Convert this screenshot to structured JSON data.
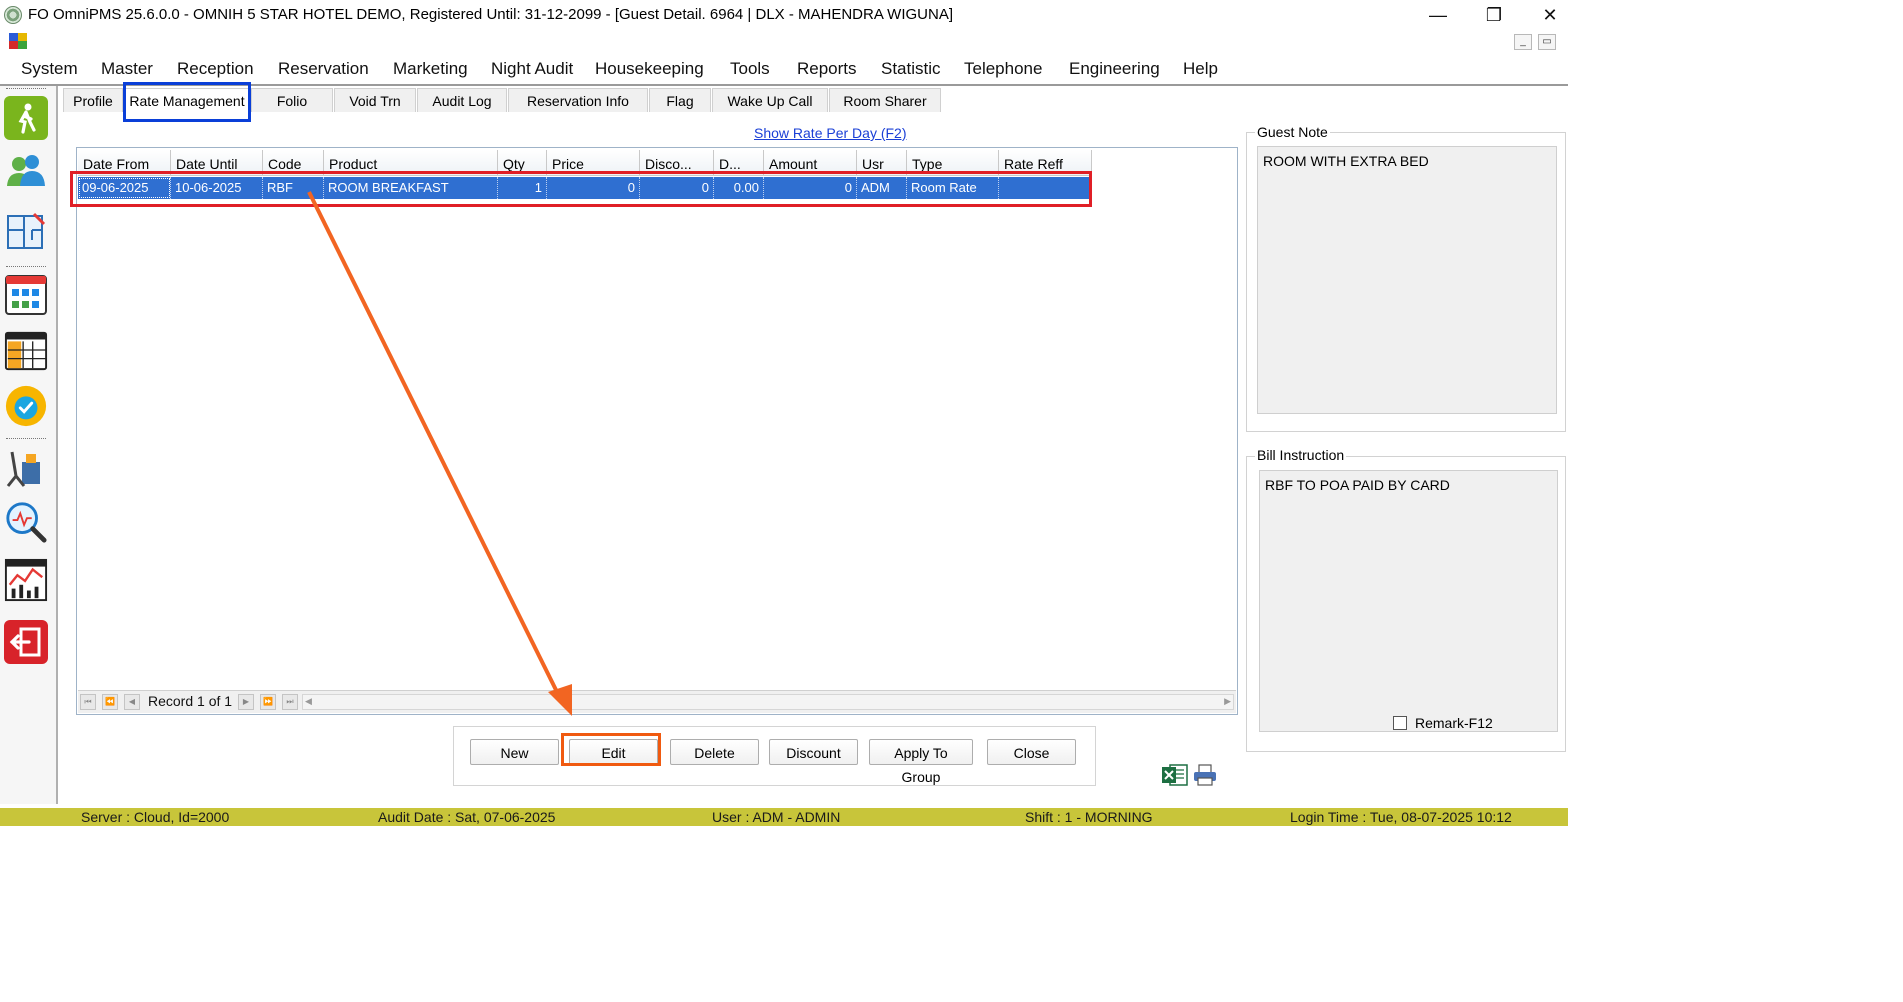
{
  "window": {
    "title": "FO OmniPMS 25.6.0.0 - OMNIH 5 STAR HOTEL DEMO, Registered Until: 31-12-2099 - [Guest Detail. 6964 | DLX - MAHENDRA WIGUNA]",
    "minimize": "—",
    "restore": "❐",
    "close": "✕"
  },
  "mdi": {
    "minimize": "_",
    "restore": "▭"
  },
  "menu": [
    "System",
    "Master",
    "Reception",
    "Reservation",
    "Marketing",
    "Night Audit",
    "Housekeeping",
    "Tools",
    "Reports",
    "Statistic",
    "Telephone",
    "Engineering",
    "Help"
  ],
  "sidebar_icons": [
    "walk-in-icon",
    "guests-icon",
    "floor-plan-icon",
    "room-grid-calendar-icon",
    "calendar-2023-icon",
    "availability-badge-icon",
    "housekeeping-icon",
    "analytics-search-icon",
    "report-chart-icon",
    "logout-icon"
  ],
  "tabs": [
    "Profile",
    "Rate Management",
    "Folio",
    "Void Trn",
    "Audit Log",
    "Reservation Info",
    "Flag",
    "Wake Up Call",
    "Room Sharer"
  ],
  "active_tab": "Rate Management",
  "show_rate_link": "Show Rate Per Day (F2)",
  "grid": {
    "columns": [
      "Date From",
      "Date Until",
      "Code",
      "Product",
      "Qty",
      "Price",
      "Disco...",
      "D...",
      "Amount",
      "Usr",
      "Type",
      "Rate Reff"
    ],
    "rows": [
      [
        "09-06-2025",
        "10-06-2025",
        "RBF",
        "ROOM BREAKFAST",
        "1",
        "0",
        "0",
        "0.00",
        "0",
        "ADM",
        "Room Rate",
        ""
      ]
    ]
  },
  "navigator": {
    "record_text": "Record 1 of 1"
  },
  "buttons": {
    "new": "New",
    "edit": "Edit",
    "delete": "Delete",
    "discount": "Discount",
    "apply_to_group": "Apply To Group",
    "close": "Close"
  },
  "guest_note": {
    "label": "Guest Note",
    "text": "ROOM WITH EXTRA BED"
  },
  "bill_instruction": {
    "label": "Bill Instruction",
    "text": "RBF TO POA PAID BY CARD"
  },
  "remark": {
    "label": "Remark-F12",
    "checked": false
  },
  "status": {
    "server": "Server : Cloud, Id=2000",
    "audit_date": "Audit Date : Sat, 07-06-2025",
    "user": "User : ADM - ADMIN",
    "shift": "Shift : 1 - MORNING",
    "login_time": "Login Time : Tue, 08-07-2025 10:12"
  },
  "colors": {
    "selected_row": "#2f6fd1",
    "status_bar": "#c8c53a",
    "link": "#1a3fd6",
    "highlight_blue": "#0a3fd8",
    "highlight_red": "#e01f26",
    "highlight_orange": "#f05a10",
    "arrow": "#f26522"
  }
}
